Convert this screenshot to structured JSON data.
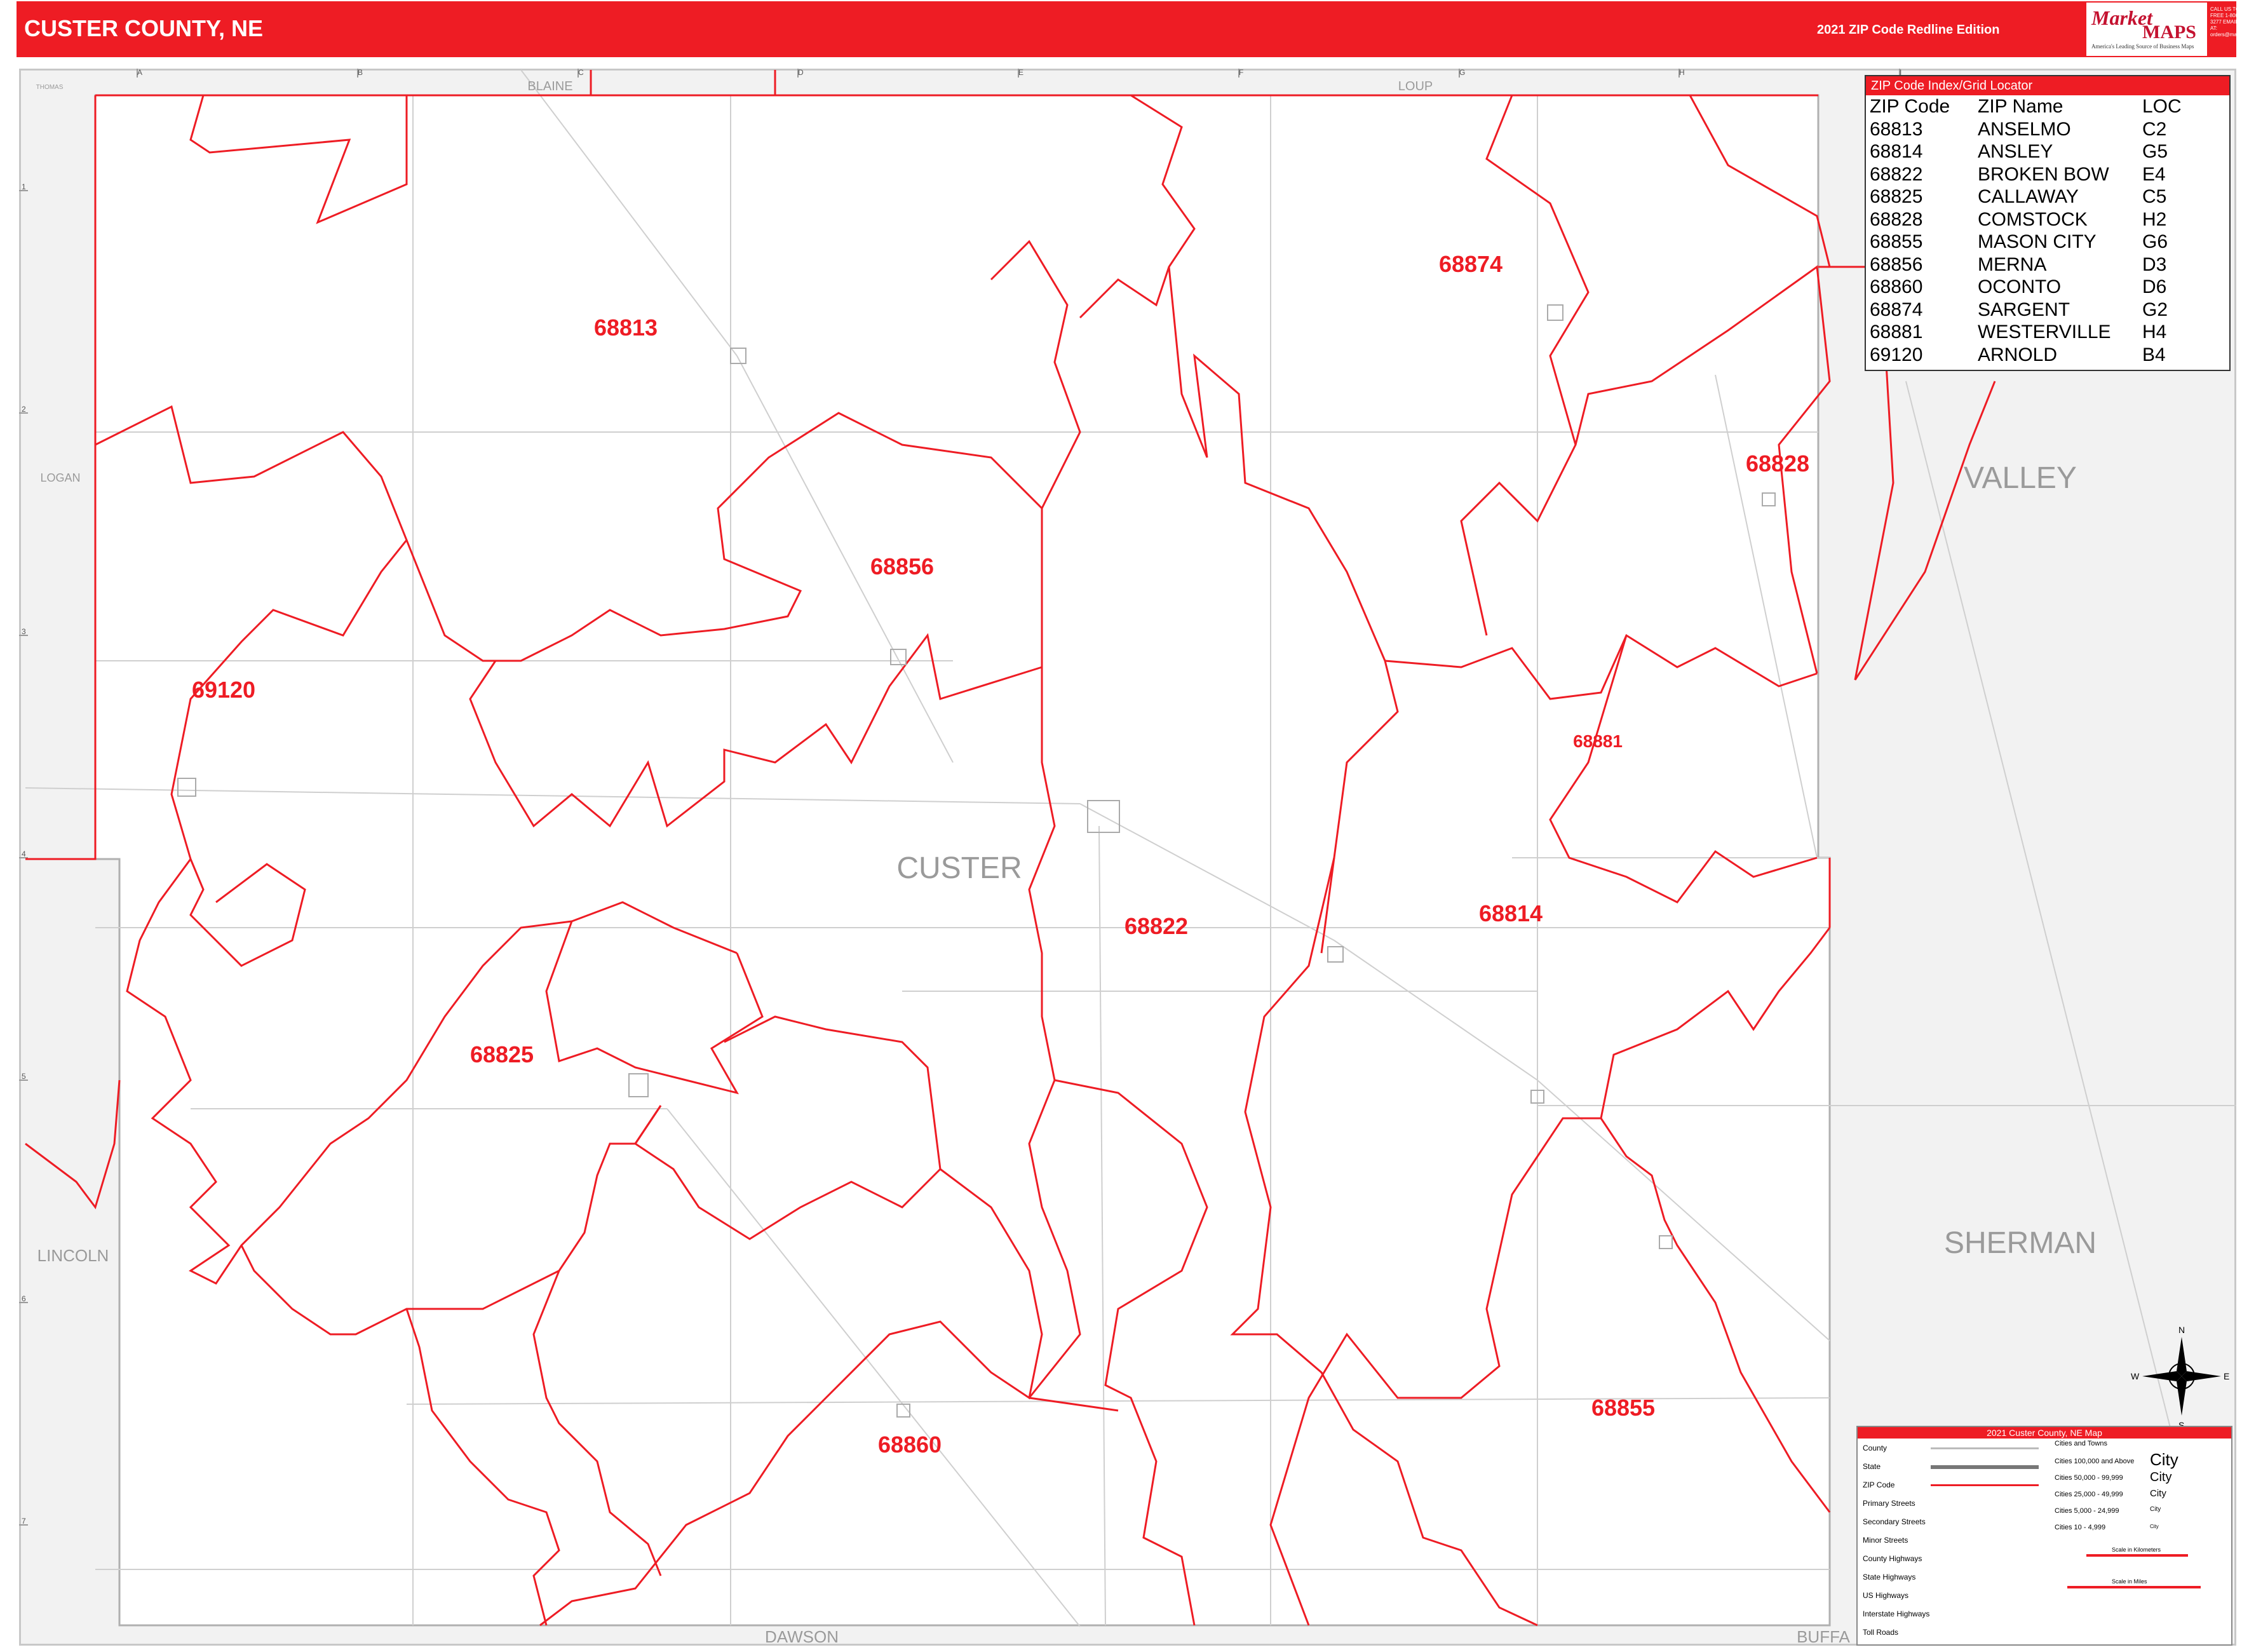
{
  "header": {
    "title": "CUSTER COUNTY, NE",
    "edition": "2021 ZIP Code Redline Edition",
    "logo_text_1": "Market",
    "logo_text_2": "MAPS",
    "logo_tagline": "America's Leading Source of Business Maps",
    "phone_text": "CALL US TOLL FREE 1-800-334-3277 EMAIL US AT: orders@marketmaps.com"
  },
  "colors": {
    "header_red": "#ee1c24",
    "zip_boundary": "#ee1c24",
    "zip_label": "#ee1c24",
    "county_name": "#9a9a9a",
    "road": "#c8c8c8",
    "outside_county": "#f2f2f2"
  },
  "grid": {
    "columns": [
      "A",
      "B",
      "C",
      "D",
      "E",
      "F",
      "G",
      "H",
      "I"
    ],
    "rows": [
      "1",
      "2",
      "3",
      "4",
      "5",
      "6",
      "7"
    ]
  },
  "map": {
    "county_label": "CUSTER",
    "neighbors": {
      "blaine": "BLAINE",
      "loup": "LOUP",
      "logan": "LOGAN",
      "valley": "VALLEY",
      "lincoln": "LINCOLN",
      "sherman": "SHERMAN",
      "dawson": "DAWSON",
      "buffalo": "BUFFA",
      "thomas": "THOMAS"
    },
    "zip_labels": {
      "z68813": "68813",
      "z68874": "68874",
      "z68828": "68828",
      "z68856": "68856",
      "z69120": "69120",
      "z68881": "68881",
      "z68822": "68822",
      "z68814": "68814",
      "z68825": "68825",
      "z68860": "68860",
      "z68855": "68855"
    }
  },
  "zip_index": {
    "title": "ZIP Code Index/Grid Locator",
    "columns": [
      "ZIP Code",
      "ZIP Name",
      "LOC"
    ],
    "rows": [
      {
        "zip": "68813",
        "name": "ANSELMO",
        "loc": "C2"
      },
      {
        "zip": "68814",
        "name": "ANSLEY",
        "loc": "G5"
      },
      {
        "zip": "68822",
        "name": "BROKEN BOW",
        "loc": "E4"
      },
      {
        "zip": "68825",
        "name": "CALLAWAY",
        "loc": "C5"
      },
      {
        "zip": "68828",
        "name": "COMSTOCK",
        "loc": "H2"
      },
      {
        "zip": "68855",
        "name": "MASON CITY",
        "loc": "G6"
      },
      {
        "zip": "68856",
        "name": "MERNA",
        "loc": "D3"
      },
      {
        "zip": "68860",
        "name": "OCONTO",
        "loc": "D6"
      },
      {
        "zip": "68874",
        "name": "SARGENT",
        "loc": "G2"
      },
      {
        "zip": "68881",
        "name": "WESTERVILLE",
        "loc": "H4"
      },
      {
        "zip": "69120",
        "name": "ARNOLD",
        "loc": "B4"
      }
    ]
  },
  "legend": {
    "title": "2021 Custer County, NE Map",
    "items": [
      "County",
      "State",
      "ZIP Code",
      "Primary Streets",
      "Secondary Streets",
      "Minor Streets",
      "County Highways",
      "State Highways",
      "US Highways",
      "Interstate Highways",
      "Toll Roads"
    ],
    "cities_title": "Cities and Towns",
    "cities": [
      {
        "range": "Cities 100,000 and Above",
        "sample": "City"
      },
      {
        "range": "Cities 50,000 - 99,999",
        "sample": "City"
      },
      {
        "range": "Cities 25,000 - 49,999",
        "sample": "City"
      },
      {
        "range": "Cities 5,000 - 24,999",
        "sample": "City"
      },
      {
        "range": "Cities 10 - 4,999",
        "sample": "City"
      }
    ],
    "scale_km": "Scale in Kilometers",
    "scale_mi": "Scale in Miles"
  },
  "compass": {
    "n": "N",
    "s": "S",
    "e": "E",
    "w": "W"
  }
}
